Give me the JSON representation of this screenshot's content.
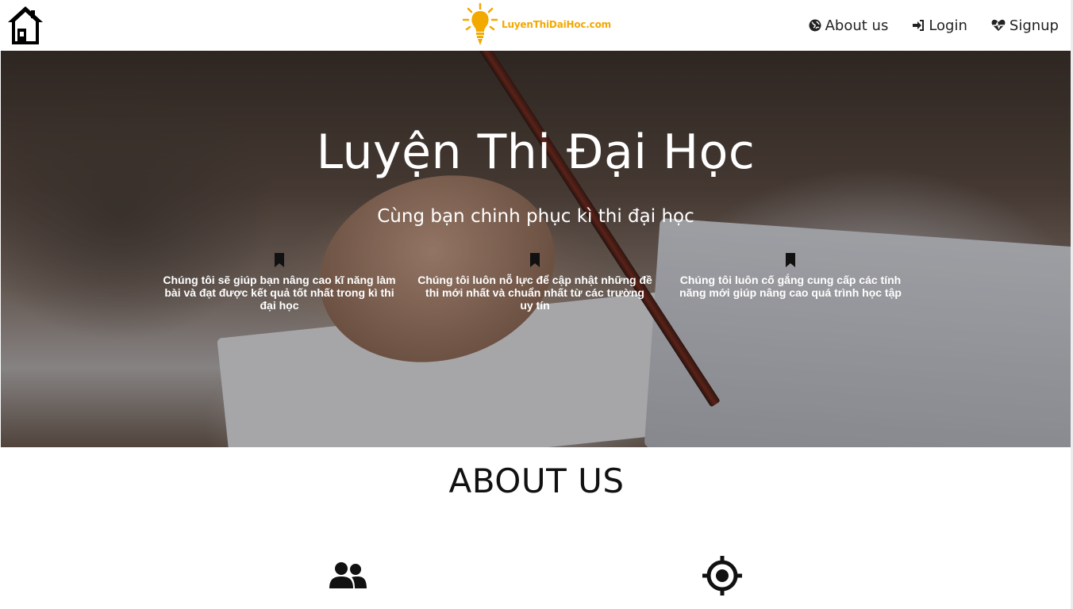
{
  "header": {
    "logo_text": "LuyenThiDaiHoc.com",
    "nav": [
      {
        "label": "About us",
        "icon": "globe-icon"
      },
      {
        "label": "Login",
        "icon": "sign-in-icon"
      },
      {
        "label": "Signup",
        "icon": "heartbeat-icon"
      }
    ]
  },
  "hero": {
    "title": "Luyện Thi Đại Học",
    "subtitle": "Cùng bạn chinh phục kì thi đại học",
    "features": [
      {
        "icon": "bookmark-icon",
        "text": "Chúng tôi sẽ giúp bạn nâng cao kĩ năng làm bài và đạt được kết quả tốt nhất trong kì thi đại học"
      },
      {
        "icon": "bookmark-icon",
        "text": "Chúng tôi luôn nỗ lực để cập nhật những đề thi mới nhất và chuẩn nhất từ các trường uy tín"
      },
      {
        "icon": "bookmark-icon",
        "text": "Chúng tôi luôn cố gắng cung cấp các tính năng mới giúp nâng cao quá trình học tập"
      }
    ]
  },
  "about": {
    "title": "ABOUT US",
    "icons": [
      "users-icon",
      "crosshairs-icon"
    ]
  },
  "colors": {
    "logo_accent": "#f2a900",
    "text_dark": "#111111",
    "hero_text": "#ffffff"
  }
}
